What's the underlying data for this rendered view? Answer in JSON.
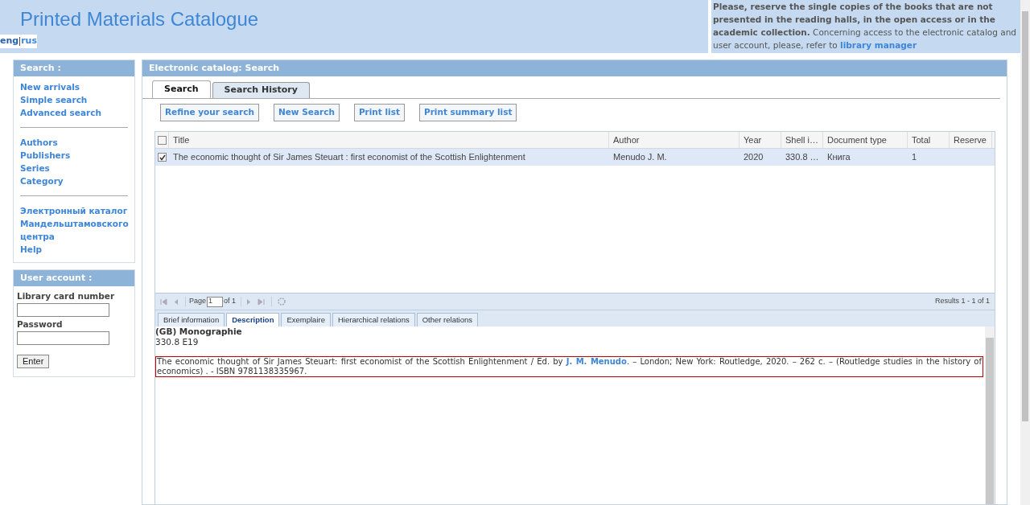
{
  "header": {
    "title": "Printed Materials Catalogue",
    "languages": [
      {
        "label": "eng",
        "selected": true
      },
      {
        "label": "rus",
        "selected": false
      }
    ]
  },
  "notice": {
    "bold_text": "Please, reserve the single copies of the books that are not presented in the reading halls, in the open access or in the academic collection.",
    "text": "Concerning access to the electronic catalog and user account, please, refer to",
    "link": "library manager"
  },
  "sidebar": {
    "search_title": "Search :",
    "groups": [
      [
        "New arrivals",
        "Simple search",
        "Advanced search"
      ],
      [
        "Authors",
        "Publishers",
        "Series",
        "Category"
      ],
      [
        "Электронный каталог Мандельштамовского центра",
        "Help"
      ]
    ],
    "account": {
      "title": "User account :",
      "card_label": "Library card number",
      "password_label": "Password",
      "button": "Enter"
    }
  },
  "main": {
    "title": "Electronic catalog: Search",
    "tabs": [
      {
        "label": "Search",
        "selected": true
      },
      {
        "label": "Search History",
        "selected": false
      }
    ],
    "buttons": [
      "Refine your search",
      "New Search",
      "Print list",
      "Print summary list"
    ],
    "table": {
      "header_checked": false,
      "columns": [
        "Title",
        "Author",
        "Year",
        "Shell i…",
        "Document type",
        "Total",
        "Reserve"
      ],
      "rows": [
        {
          "checked": true,
          "selected": true,
          "cells": [
            "The economic thought of Sir James Steuart : first economist of the Scottish Enlightenment",
            "Menudo J. M.",
            "2020",
            "330.8 …",
            "Книга",
            "1",
            ""
          ]
        }
      ]
    },
    "pager": {
      "page_label": "Page",
      "page": "1",
      "of": "of 1",
      "results": "Results 1 - 1 of 1"
    },
    "detail_tabs": [
      {
        "label": "Brief information",
        "selected": false
      },
      {
        "label": "Description",
        "selected": true
      },
      {
        "label": "Exemplaire",
        "selected": false
      },
      {
        "label": "Hierarchical relations",
        "selected": false
      },
      {
        "label": "Other relations",
        "selected": false
      }
    ],
    "description": {
      "heading": "(GB) Monographie",
      "code": "330.8 E19",
      "text_before": "The economic thought of Sir James Steuart: first economist of the Scottish Enlightenment / Ed. by",
      "author_link": "J. M. Menudo",
      "text_after": ". – London; New York: Routledge, 2020. – 262 с. – (Routledge studies in the history of economics) . - ISBN 9781138335967."
    }
  }
}
